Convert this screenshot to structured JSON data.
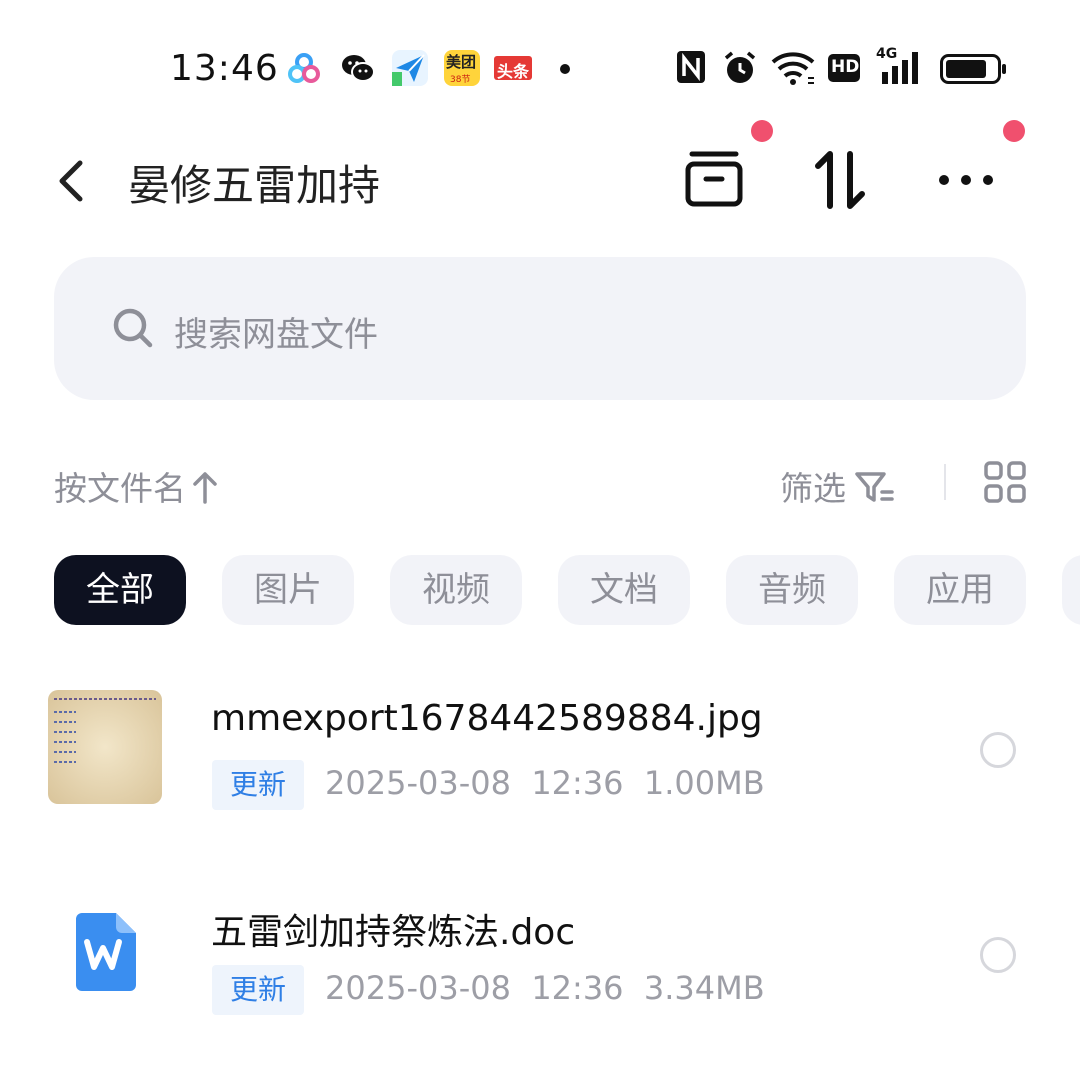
{
  "status_bar": {
    "time": "13:46",
    "app_icons": [
      "baidu-netdisk-icon",
      "wechat-icon",
      "paper-plane-icon",
      "meituan-icon",
      "toutiao-icon"
    ],
    "meituan_label": "美团",
    "meituan_sub": "38节",
    "toutiao_label": "头条",
    "system_icons": [
      "nfc-icon",
      "alarm-icon",
      "wifi-icon",
      "hd-icon",
      "signal-4g-icon",
      "battery-icon"
    ],
    "hd_label": "HD",
    "network_label": "4G"
  },
  "header": {
    "title": "晏修五雷加持",
    "back_icon": "chevron-left-icon",
    "actions": [
      "archive-icon",
      "transfer-icon",
      "more-icon"
    ]
  },
  "search": {
    "placeholder": "搜索网盘文件",
    "icon": "search-icon"
  },
  "toolbar": {
    "sort_label": "按文件名",
    "filter_label": "筛选",
    "view_icon": "grid-view-icon"
  },
  "tabs": [
    {
      "label": "全部",
      "active": true
    },
    {
      "label": "图片",
      "active": false
    },
    {
      "label": "视频",
      "active": false
    },
    {
      "label": "文档",
      "active": false
    },
    {
      "label": "音频",
      "active": false
    },
    {
      "label": "应用",
      "active": false
    }
  ],
  "files": [
    {
      "name": "mmexport1678442589884.jpg",
      "tag": "更新",
      "date": "2025-03-08",
      "time": "12:36",
      "size": "1.00MB",
      "type": "image"
    },
    {
      "name": "五雷剑加持祭炼法.doc",
      "tag": "更新",
      "date": "2025-03-08",
      "time": "12:36",
      "size": "3.34MB",
      "type": "word"
    }
  ],
  "colors": {
    "accent_blue": "#2f7fe5",
    "notification_dot": "#f0506e",
    "active_tab_bg": "#0d1120",
    "chip_bg": "#f2f3f8"
  }
}
